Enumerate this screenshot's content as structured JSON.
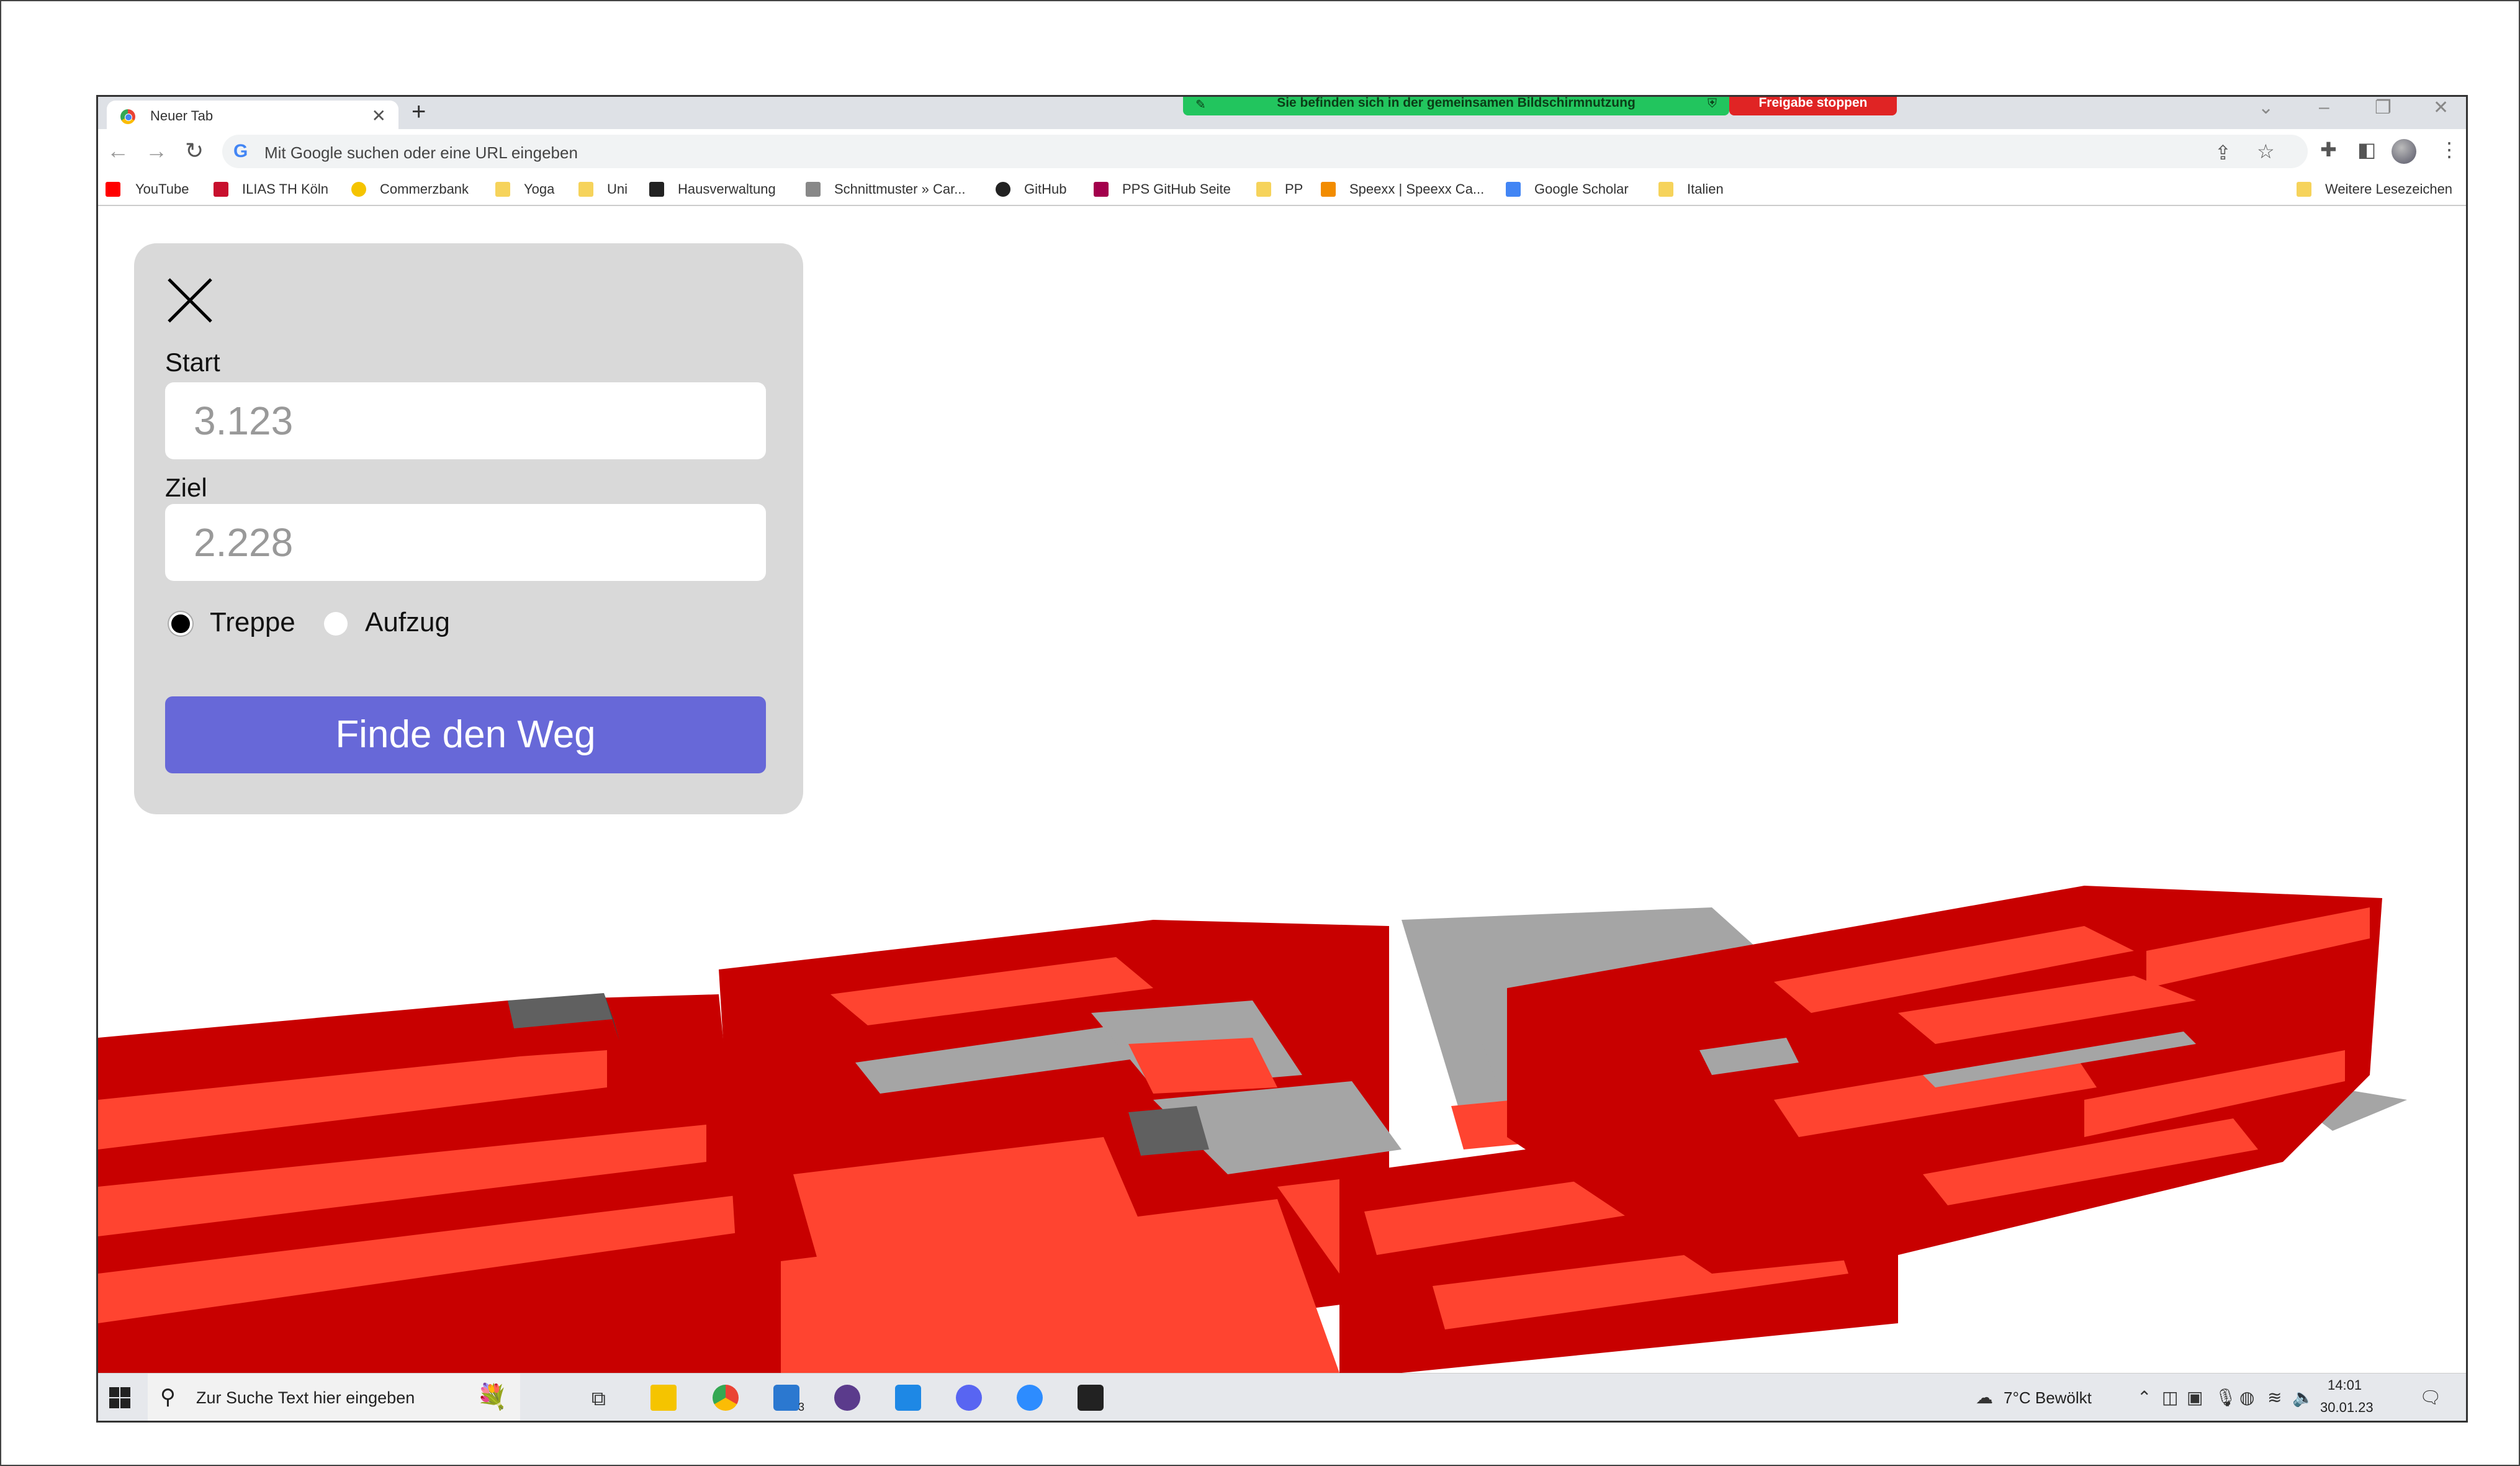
{
  "browser": {
    "tab_title": "Neuer Tab",
    "new_tab": "+",
    "share_bar": {
      "message": "Sie befinden sich in der gemeinsamen Bildschirmnutzung",
      "stop_label": "Freigabe stoppen"
    },
    "omnibox_placeholder": "Mit Google suchen oder eine URL eingeben",
    "bookmarks": [
      {
        "label": "YouTube",
        "icon": "youtube-icon",
        "color": "#ff0000"
      },
      {
        "label": "ILIAS TH Köln",
        "icon": "ilias-icon",
        "color": "#c8102e"
      },
      {
        "label": "Commerzbank",
        "icon": "commerzbank-icon",
        "color": "#f5c400"
      },
      {
        "label": "Yoga",
        "icon": "folder-icon",
        "color": "#f6d35b"
      },
      {
        "label": "Uni",
        "icon": "folder-icon",
        "color": "#f6d35b"
      },
      {
        "label": "Hausverwaltung",
        "icon": "hausverwaltung-icon",
        "color": "#222222"
      },
      {
        "label": "Schnittmuster » Car...",
        "icon": "sewing-icon",
        "color": "#888888"
      },
      {
        "label": "GitHub",
        "icon": "github-icon",
        "color": "#222222"
      },
      {
        "label": "PPS GitHub Seite",
        "icon": "pps-icon",
        "color": "#a3004c"
      },
      {
        "label": "PP",
        "icon": "folder-icon",
        "color": "#f6d35b"
      },
      {
        "label": "Speexx | Speexx Ca...",
        "icon": "speexx-icon",
        "color": "#f28c00"
      },
      {
        "label": "Google Scholar",
        "icon": "scholar-icon",
        "color": "#4285f4"
      },
      {
        "label": "Italien",
        "icon": "folder-icon",
        "color": "#f6d35b"
      }
    ],
    "other_bookmarks": "Weitere Lesezeichen"
  },
  "panel": {
    "start_label": "Start",
    "start_placeholder": "3.123",
    "ziel_label": "Ziel",
    "ziel_placeholder": "2.228",
    "radio_options": [
      {
        "label": "Treppe",
        "selected": true
      },
      {
        "label": "Aufzug",
        "selected": false
      }
    ],
    "button_label": "Finde den Weg",
    "colors": {
      "panel_bg": "#d9d9d9",
      "button_bg": "#6768d8"
    }
  },
  "scene_colors": {
    "wall_dark": "#c80000",
    "floor_light": "#ff4430",
    "floor_grey": "#a5a5a5",
    "stair_dark": "#606060"
  },
  "taskbar": {
    "search_placeholder": "Zur Suche Text hier eingeben",
    "mail_badge": "3",
    "weather": "7°C  Bewölkt",
    "time": "14:01",
    "date": "30.01.23"
  }
}
